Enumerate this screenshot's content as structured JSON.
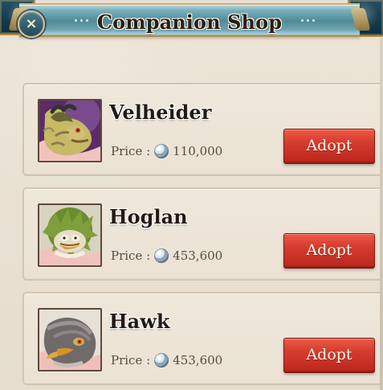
{
  "header": {
    "title": "Companion Shop"
  },
  "icons": {
    "close": "×"
  },
  "shop": {
    "items": [
      {
        "name": "Velheider",
        "price_label": "Price :",
        "price_value": "110,000",
        "button_label": "Adopt",
        "portrait_icon": "dragon-icon"
      },
      {
        "name": "Hoglan",
        "price_label": "Price :",
        "price_value": "453,600",
        "button_label": "Adopt",
        "portrait_icon": "leafy-creature-icon"
      },
      {
        "name": "Hawk",
        "price_label": "Price :",
        "price_value": "453,600",
        "button_label": "Adopt",
        "portrait_icon": "hawk-icon"
      }
    ]
  },
  "colors": {
    "header_teal": "#4f8a97",
    "button_red": "#d63d2f",
    "background": "#e7dfd1"
  }
}
